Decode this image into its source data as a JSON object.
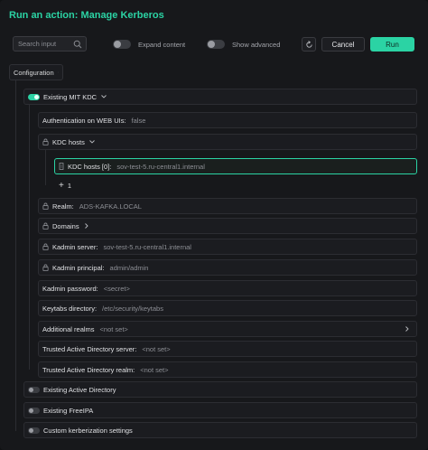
{
  "dialog": {
    "title": "Run an action: Manage Kerberos"
  },
  "toolbar": {
    "search_placeholder": "Search input",
    "expand_label": "Expand content",
    "advanced_label": "Show advanced",
    "cancel_label": "Cancel",
    "run_label": "Run"
  },
  "tree": {
    "configuration_label": "Configuration",
    "mit_kdc_label": "Existing MIT KDC",
    "auth_label": "Authentication on WEB UIs:",
    "auth_value": "false",
    "kdc_hosts_label": "KDC hosts",
    "kdc_host0_label": "KDC hosts [0]:",
    "kdc_host0_value": "sov-test-5.ru-central1.internal",
    "add_count": "1",
    "realm_label": "Realm:",
    "realm_value": "ADS-KAFKA.LOCAL",
    "domains_label": "Domains",
    "kadmin_server_label": "Kadmin server:",
    "kadmin_server_value": "sov-test-5.ru-central1.internal",
    "kadmin_principal_label": "Kadmin principal:",
    "kadmin_principal_value": "admin/admin",
    "kadmin_password_label": "Kadmin password:",
    "kadmin_password_value": "<secret>",
    "keytabs_label": "Keytabs directory:",
    "keytabs_value": "/etc/security/keytabs",
    "additional_realms_label": "Additional realms",
    "additional_realms_value": "<not set>",
    "trusted_server_label": "Trusted Active Directory server:",
    "trusted_server_value": "<not set>",
    "trusted_realm_label": "Trusted Active Directory realm:",
    "trusted_realm_value": "<not set>",
    "existing_ad_label": "Existing Active Directory",
    "existing_freeipa_label": "Existing FreeIPA",
    "custom_label": "Custom kerberization settings"
  },
  "colors": {
    "accent": "#2bd3a4",
    "background": "#17181b"
  }
}
